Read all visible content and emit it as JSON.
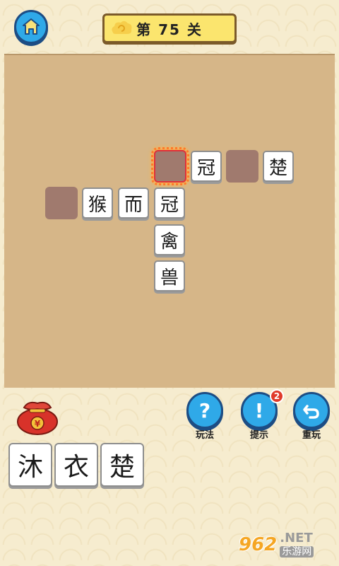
{
  "header": {
    "home_icon": "home-icon",
    "level_label": "第 75 关"
  },
  "board": {
    "tiles": {
      "r1_guan": "冠",
      "r1_chu": "楚",
      "r2_hou": "猴",
      "r2_er": "而",
      "r2_guan": "冠",
      "r3_qin": "禽",
      "r4_shou": "兽"
    }
  },
  "controls": {
    "rules": {
      "icon": "?",
      "label": "玩法"
    },
    "hint": {
      "icon": "!",
      "label": "提示",
      "badge": "2"
    },
    "restart": {
      "icon": "undo-arrow-icon",
      "label": "重玩"
    }
  },
  "candidates": [
    "沐",
    "衣",
    "楚"
  ],
  "watermark": {
    "logo": "962",
    "net": ".NET",
    "cn": "乐游网"
  },
  "colors": {
    "accent_blue": "#2fa9e8",
    "board_bg": "#d6b688",
    "slot_bg": "#a07a6e",
    "banner_yellow": "#fbe56e"
  }
}
